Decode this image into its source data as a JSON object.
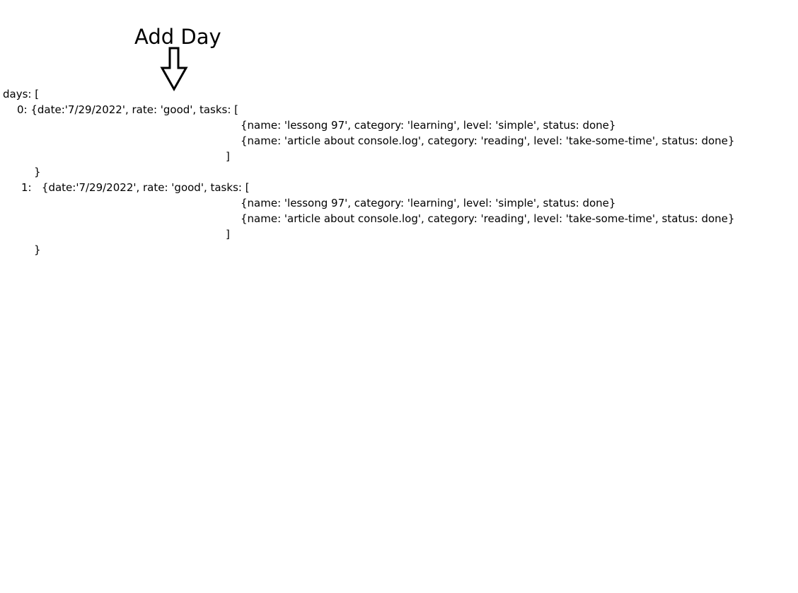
{
  "title": "Add Day",
  "code": {
    "days_open": "days: [",
    "day_0_head": "0: {date:'7/29/2022', rate: 'good', tasks: [",
    "day_0_task_0": "{name: 'lessong 97', category: 'learning', level: 'simple', status: done}",
    "day_0_task_1": "{name: 'article about console.log', category: 'reading', level: 'take-some-time', status: done}",
    "day_0_tasks_close": "]",
    "day_0_close": "}",
    "day_1_head": "1:   {date:'7/29/2022', rate: 'good', tasks: [",
    "day_1_task_0": "{name: 'lessong 97', category: 'learning', level: 'simple', status: done}",
    "day_1_task_1": "{name: 'article about console.log', category: 'reading', level: 'take-some-time', status: done}",
    "day_1_tasks_close": "]",
    "day_1_close": "}"
  }
}
